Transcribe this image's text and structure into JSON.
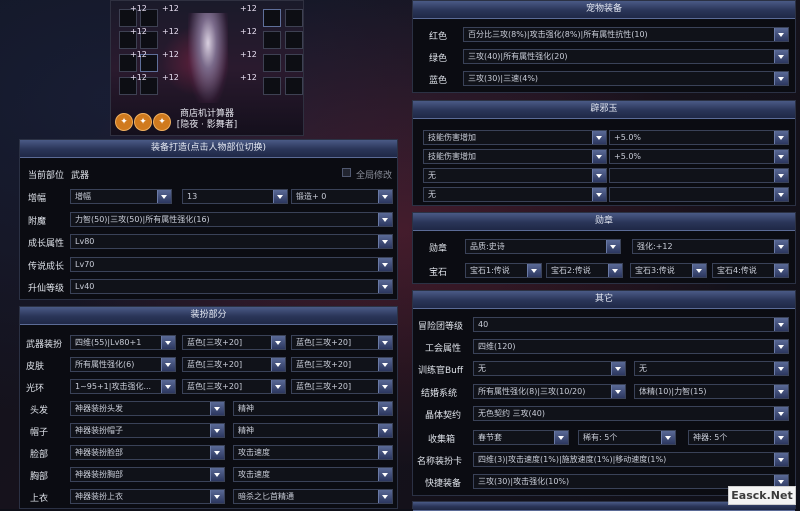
{
  "character": {
    "plus_labels": [
      "+12",
      "+12",
      "+12",
      "+12",
      "+12",
      "+12",
      "+12",
      "+12",
      "+12",
      "+12",
      "+12",
      "+12"
    ],
    "name_line1": "商店机计算器",
    "name_line2": "[隐夜 · 影舞者]"
  },
  "equip_panel": {
    "title": "装备打造(点击人物部位切换)",
    "current_slot_label": "当前部位",
    "current_slot_value": "武器",
    "all_modify_label": "全局修改",
    "rows": [
      {
        "label": "增幅",
        "values": [
          "增幅",
          "13",
          "锻造+ 0"
        ]
      },
      {
        "label": "附魔",
        "values": [
          "力智(50)|三攻(50)|所有属性强化(16)"
        ]
      },
      {
        "label": "成长属性",
        "values": [
          "Lv80"
        ]
      },
      {
        "label": "传说成长",
        "values": [
          "Lv70"
        ]
      },
      {
        "label": "升仙等级",
        "values": [
          "Lv40"
        ]
      }
    ]
  },
  "dress_panel": {
    "title": "装扮部分",
    "rows": [
      {
        "label": "武器装扮",
        "values": [
          "四维(55)|Lv80+1",
          "蓝色[三攻+20]",
          "蓝色[三攻+20]"
        ]
      },
      {
        "label": "皮肤",
        "values": [
          "所有属性强化(6)",
          "蓝色[三攻+20]",
          "蓝色[三攻+20]"
        ]
      },
      {
        "label": "光环",
        "values": [
          "1~95+1|攻击强化...",
          "蓝色[三攻+20]",
          "蓝色[三攻+20]"
        ]
      },
      {
        "label": "头发",
        "values": [
          "神器装扮头发",
          "精神"
        ]
      },
      {
        "label": "帽子",
        "values": [
          "神器装扮帽子",
          "精神"
        ]
      },
      {
        "label": "脸部",
        "values": [
          "神器装扮脸部",
          "攻击速度"
        ]
      },
      {
        "label": "胸部",
        "values": [
          "神器装扮胸部",
          "攻击速度"
        ]
      },
      {
        "label": "上衣",
        "values": [
          "神器装扮上衣",
          "暗杀之匕首精通"
        ]
      }
    ]
  },
  "pet_panel": {
    "title": "宠物装备",
    "rows": [
      {
        "label": "红色",
        "values": [
          "百分比三攻(8%)|攻击强化(8%)|所有属性抗性(10)"
        ]
      },
      {
        "label": "绿色",
        "values": [
          "三攻(40)|所有属性强化(20)"
        ]
      },
      {
        "label": "蓝色",
        "values": [
          "三攻(30)|三速(4%)"
        ]
      }
    ]
  },
  "charm_panel": {
    "title": "辟邪玉",
    "rows": [
      {
        "values": [
          "技能伤害增加",
          "+5.0%"
        ]
      },
      {
        "values": [
          "技能伤害增加",
          "+5.0%"
        ]
      },
      {
        "values": [
          "无",
          ""
        ]
      },
      {
        "values": [
          "无",
          ""
        ]
      }
    ]
  },
  "medal_panel": {
    "title": "勋章",
    "rows": [
      {
        "label": "勋章",
        "values": [
          "品质:史诗",
          "强化:+12"
        ]
      },
      {
        "label": "宝石",
        "values": [
          "宝石1:传说",
          "宝石2:传说",
          "宝石3:传说",
          "宝石4:传说"
        ]
      }
    ]
  },
  "other_panel": {
    "title": "其它",
    "rows": [
      {
        "label": "冒险团等级",
        "values": [
          "40"
        ]
      },
      {
        "label": "工会属性",
        "values": [
          "四维(120)"
        ]
      },
      {
        "label": "训练官Buff",
        "values": [
          "无",
          "无"
        ]
      },
      {
        "label": "结婚系统",
        "values": [
          "所有属性强化(8)|三攻(10/20)",
          "体精(10)|力智(15)"
        ]
      },
      {
        "label": "晶体契约",
        "values": [
          "无色契约  三攻(40)"
        ]
      },
      {
        "label": "收集箱",
        "values": [
          "春节套",
          "稀有: 5个",
          "神器: 5个"
        ]
      },
      {
        "label": "名称装扮卡",
        "values": [
          "四维(3)|攻击速度(1%)|施放速度(1%)|移动速度(1%)"
        ]
      },
      {
        "label": "快捷装备",
        "values": [
          "三攻(30)|攻击强化(10%)"
        ]
      }
    ]
  },
  "watermark": "Easck.Net"
}
